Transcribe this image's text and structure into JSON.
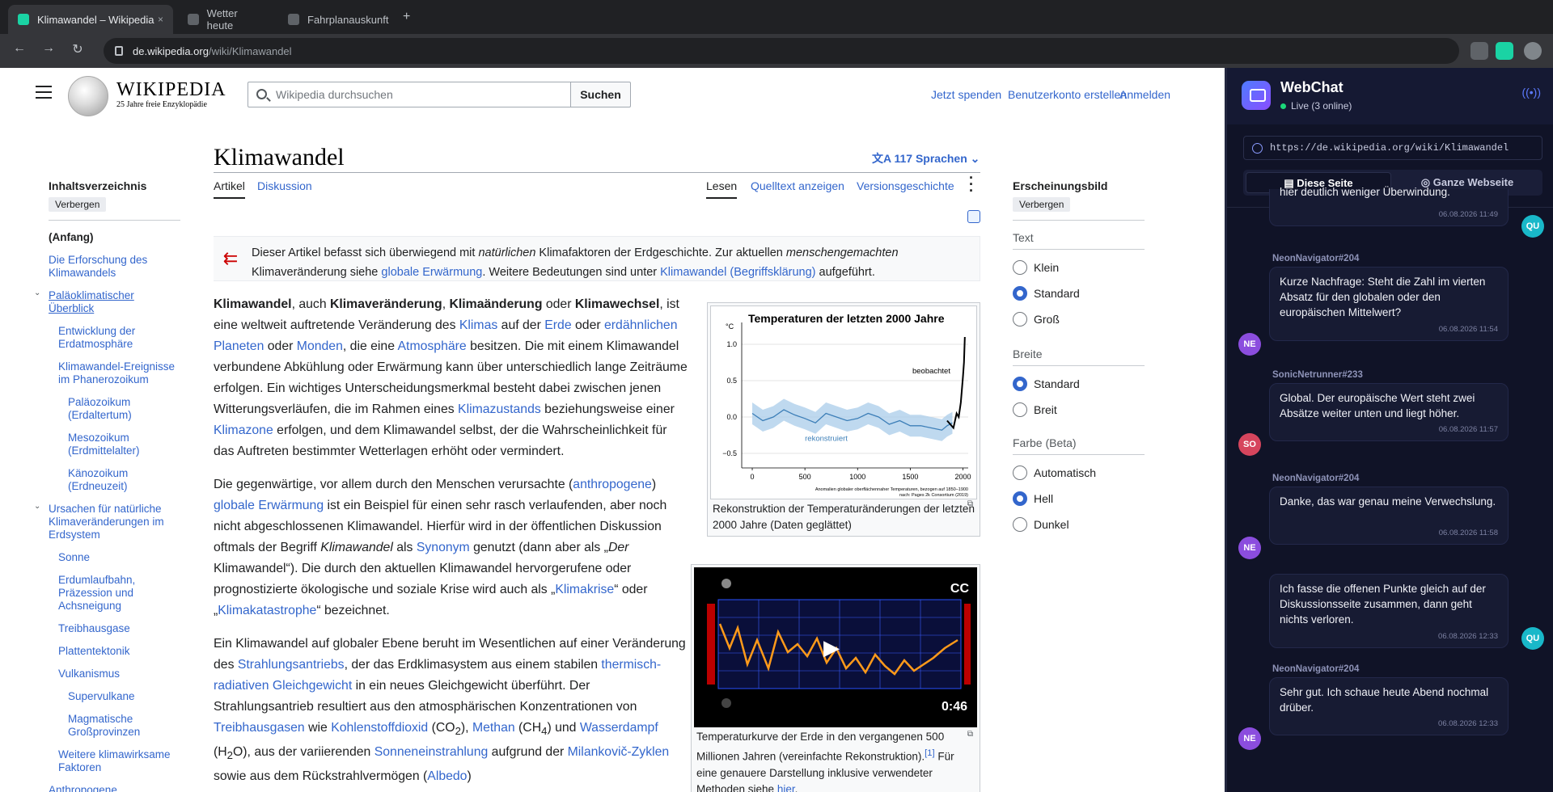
{
  "browser": {
    "tabs": [
      {
        "label": "Klimawandel – Wikipedia",
        "active": true
      },
      {
        "label": "Wetter heute",
        "active": false
      },
      {
        "label": "Fahrplanauskunft",
        "active": false
      }
    ],
    "url_host": "de.wikipedia.org",
    "url_path": "/wiki/Klimawandel",
    "close_glyph": "×",
    "newtab_glyph": "+"
  },
  "wiki": {
    "wordmark": "WIKIPEDIA",
    "tagline": "25 Jahre freie Enzyklopädie",
    "search_placeholder": "Wikipedia durchsuchen",
    "search_button": "Suchen",
    "top_links": [
      "Jetzt spenden",
      "Benutzerkonto erstellen",
      "Anmelden"
    ],
    "toc": {
      "title": "Inhaltsverzeichnis",
      "hide": "Verbergen",
      "items": [
        "(Anfang)",
        "Die Erforschung des Klimawandels",
        "Paläoklimatischer Überblick",
        "Entwicklung der Erdatmosphäre",
        "Klimawandel-Ereignisse im Phanerozoikum",
        "Paläozoikum (Erdaltertum)",
        "Mesozoikum (Erdmittelalter)",
        "Känozoikum (Erdneuzeit)",
        "Ursachen für natürliche Klimaveränderungen im Erdsystem",
        "Sonne",
        "Erdumlaufbahn, Präzession und Achsneigung",
        "Treibhausgase",
        "Plattentektonik",
        "Vulkanismus",
        "Supervulkane",
        "Magmatische Großprovinzen",
        "Weitere klimawirksame Faktoren",
        "Anthropogene"
      ]
    },
    "title": "Klimawandel",
    "languages": "117 Sprachen",
    "page_tabs": {
      "article": "Artikel",
      "talk": "Diskussion",
      "read": "Lesen",
      "source": "Quelltext anzeigen",
      "history": "Versionsgeschichte"
    },
    "hatnote": {
      "p1": "Dieser Artikel befasst sich überwiegend mit ",
      "p2": "natürlichen",
      "p3": " Klimafaktoren der Erdgeschichte. Zur aktuellen ",
      "p4": "menschengemachten",
      "p5": " Klimaveränderung siehe ",
      "link1": "globale Erwärmung",
      "p6": ". Weitere Bedeutungen sind unter ",
      "link2": "Klimawandel (Begriffsklärung)",
      "p7": " aufgeführt."
    },
    "para1": {
      "b1": "Klimawandel",
      "t1": ", auch ",
      "b2": "Klimaveränderung",
      "t2": ", ",
      "b3": "Klimaänderung",
      "t3": " oder ",
      "b4": "Klimawechsel",
      "t4": ", ist eine weltweit auftretende Veränderung des ",
      "l1": "Klimas",
      "t5": " auf der ",
      "l2": "Erde",
      "t6": " oder ",
      "l3": "erdähnlichen Planeten",
      "t7": " oder ",
      "l4": "Monden",
      "t8": ", die eine ",
      "l5": "Atmosphäre",
      "t9": " besitzen. Die mit einem Klimawandel verbundene Abkühlung oder Erwärmung kann über unterschiedlich lange Zeiträume erfolgen. Ein wichtiges Unterscheidungsmerkmal besteht dabei zwischen jenen Witterungsverläufen, die im Rahmen eines ",
      "l6": "Klimazustands",
      "t10": " beziehungsweise einer ",
      "l7": "Klimazone",
      "t11": " erfolgen, und dem Klimawandel selbst, der die Wahrscheinlichkeit für das Auftreten bestimmter Wetterlagen erhöht oder vermindert."
    },
    "para2": {
      "t1": "Die gegenwärtige, vor allem durch den Menschen verursachte (",
      "l1": "anthropogene",
      "t2": ") ",
      "l2": "globale Erwärmung",
      "t3": " ist ein Beispiel für einen sehr rasch verlaufenden, aber noch nicht abgeschlossenen Klimawandel. Hierfür wird in der öffentlichen Diskussion oftmals der Begriff ",
      "i1": "Klimawandel",
      "t4": " als ",
      "l3": "Synonym",
      "t5": " genutzt (dann aber als „",
      "i2": "Der",
      "t6": " Klimawandel“). Die durch den aktuellen Klimawandel hervorgerufene oder prognostizierte ökologische und soziale Krise wird auch als „",
      "l4": "Klimakrise",
      "t7": "“ oder „",
      "l5": "Klimakatastrophe",
      "t8": "“ bezeichnet."
    },
    "para3": {
      "t1": "Ein Klimawandel auf globaler Ebene beruht im Wesentlichen auf einer Veränderung des ",
      "l1": "Strahlungsantriebs",
      "t2": ", der das Erdklimasystem aus einem stabilen ",
      "l2": "thermisch-radiativen Gleichgewicht",
      "t3": " in ein neues Gleichgewicht überführt. Der Strahlungsantrieb resultiert aus den atmosphärischen Konzentrationen von ",
      "l3": "Treibhausgasen",
      "t4": " wie ",
      "l4": "Kohlenstoffdioxid",
      "t5": " (CO",
      "s1": "2",
      "t6": "), ",
      "l5": "Methan",
      "t7": " (CH",
      "s2": "4",
      "t8": ") und ",
      "l6": "Wasserdampf",
      "t9": " (H",
      "s3": "2",
      "t10": "O), aus der variierenden ",
      "l7": "Sonneneinstrahlung",
      "t11": " aufgrund der ",
      "l8": "Milankovič-Zyklen",
      "t12": " sowie aus dem Rückstrahlvermögen (",
      "l9": "Albedo",
      "t13": ")"
    },
    "figure1": {
      "caption": "Rekonstruktion der Temperaturänderungen der letzten 2000 Jahre (Daten geglättet)"
    },
    "figure2": {
      "cc": "CC",
      "duration": "0:46",
      "caption_a": "Temperaturkurve der Erde in den vergangenen 500 Millionen Jahren (vereinfachte Rekonstruktion).",
      "ref": "[1]",
      "caption_b": " Für eine genauere Darstellung inklusive verwendeter Methoden siehe ",
      "link": "hier",
      "caption_c": "."
    },
    "appearance": {
      "title": "Erscheinungsbild",
      "hide": "Verbergen",
      "text_label": "Text",
      "text_options": [
        {
          "label": "Klein",
          "on": false
        },
        {
          "label": "Standard",
          "on": true
        },
        {
          "label": "Groß",
          "on": false
        }
      ],
      "width_label": "Breite",
      "width_options": [
        {
          "label": "Standard",
          "on": true
        },
        {
          "label": "Breit",
          "on": false
        }
      ],
      "color_label": "Farbe (Beta)",
      "color_options": [
        {
          "label": "Automatisch",
          "on": false
        },
        {
          "label": "Hell",
          "on": true
        },
        {
          "label": "Dunkel",
          "on": false
        }
      ]
    }
  },
  "chart_data": {
    "type": "line",
    "title": "Temperaturen der letzten 2000 Jahre",
    "ylabel": "°C",
    "xlim": [
      -100,
      2050
    ],
    "ylim": [
      -0.7,
      1.3
    ],
    "xticks": [
      0,
      500,
      1000,
      1500,
      2000
    ],
    "yticks": [
      -0.5,
      0.0,
      0.5,
      1.0
    ],
    "xtick_labels": [
      "0",
      "500",
      "1000",
      "1500",
      "2000"
    ],
    "ytick_labels": [
      "−0.5",
      "0.0",
      "0.5",
      "1.0"
    ],
    "note_line1": "Anomalien globaler oberflächennaher Temperaturen, bezogen auf 1850–1900",
    "note_line2": "nach: Pages 2k Consortium (2019)",
    "series": [
      {
        "name": "rekonstruiert",
        "color": "#3d7fb8",
        "x": [
          0,
          100,
          200,
          300,
          400,
          500,
          600,
          700,
          800,
          900,
          1000,
          1100,
          1200,
          1300,
          1400,
          1500,
          1600,
          1700,
          1800,
          1850,
          1900
        ],
        "y": [
          0.05,
          -0.05,
          0.0,
          0.1,
          0.03,
          -0.02,
          -0.08,
          0.05,
          0.0,
          -0.05,
          -0.02,
          0.05,
          0.0,
          -0.1,
          -0.05,
          -0.12,
          -0.12,
          -0.15,
          -0.18,
          -0.12,
          -0.08
        ],
        "band": 0.15
      },
      {
        "name": "beobachtet",
        "color": "#000000",
        "x": [
          1850,
          1880,
          1910,
          1940,
          1960,
          1980,
          2000,
          2010,
          2018
        ],
        "y": [
          -0.05,
          -0.1,
          -0.15,
          0.05,
          0.0,
          0.2,
          0.55,
          0.75,
          1.1
        ]
      }
    ]
  },
  "chat": {
    "name": "WebChat",
    "status": "Live (3 online)",
    "url": "https://de.wikipedia.org/wiki/Klimawandel",
    "tab_page": "Diese Seite",
    "tab_site": "Ganze Webseite",
    "messages": [
      {
        "author": "",
        "text": "hier deutlich weniger Überwindung.",
        "time": "06.08.2026 11:49",
        "avatar": "QU",
        "side": "right"
      },
      {
        "author": "NeonNavigator#204",
        "text": "Kurze Nachfrage: Steht die Zahl im vierten Absatz für den globalen oder den europäischen Mittelwert?",
        "time": "06.08.2026 11:54",
        "avatar": "NE",
        "side": "left"
      },
      {
        "author": "SonicNetrunner#233",
        "text": "Global. Der europäische Wert steht zwei Absätze weiter unten und liegt höher.",
        "time": "06.08.2026 11:57",
        "avatar": "SO",
        "side": "left"
      },
      {
        "author": "NeonNavigator#204",
        "text": "Danke, das war genau meine Verwechslung.",
        "time": "06.08.2026 11:58",
        "avatar": "NE",
        "side": "left"
      },
      {
        "author": "",
        "text": "Ich fasse die offenen Punkte gleich auf der Diskussionsseite zusammen, dann geht nichts verloren.",
        "time": "06.08.2026 12:33",
        "avatar": "QU",
        "side": "right"
      },
      {
        "author": "NeonNavigator#204",
        "text": "Sehr gut. Ich schaue heute Abend nochmal drüber.",
        "time": "06.08.2026 12:33",
        "avatar": "NE",
        "side": "left"
      }
    ]
  }
}
